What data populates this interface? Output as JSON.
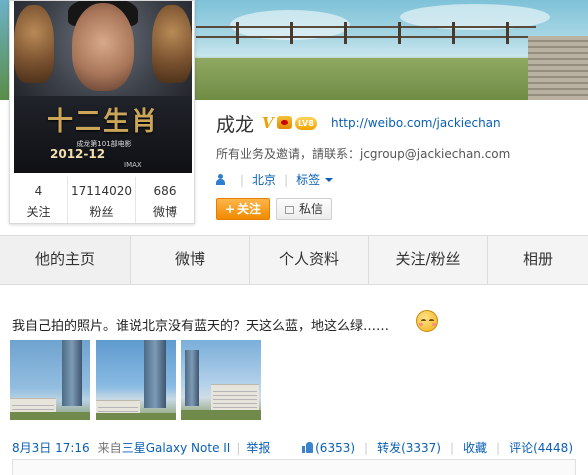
{
  "profile": {
    "name": "成龙",
    "verified_mark": "V",
    "level": "LV8",
    "homepage": "http://weibo.com/jackiechan",
    "business_contact": "所有业务及邀请，請联系：jcgroup@jackiechan.com",
    "location": "北京",
    "tags_label": "标签"
  },
  "avatar_poster": {
    "title": "十二生肖",
    "subtitle": "成龙第101部电影",
    "date": "2012-12",
    "imax": "IMAX"
  },
  "stats": {
    "following": {
      "value": "4",
      "label": "关注"
    },
    "followers": {
      "value": "17114020",
      "label": "粉丝"
    },
    "posts": {
      "value": "686",
      "label": "微博"
    }
  },
  "buttons": {
    "follow": "关注",
    "follow_plus": "+",
    "message": "私信"
  },
  "tabs": [
    "他的主页",
    "微博",
    "个人资料",
    "关注/粉丝",
    "相册"
  ],
  "post": {
    "text": "我自己拍的照片。谁说北京没有蓝天的？天这么蓝，地这么绿……",
    "date": "8月3日 17:16",
    "source_prefix": "来自",
    "device": "三星Galaxy Note II",
    "report": "举报",
    "likes": "(6353)",
    "repost": "转发(3337)",
    "favorite": "收藏",
    "comment": "评论(4448)"
  },
  "colors": {
    "link": "#0a5fb4",
    "follow_button": "#f08a00"
  }
}
